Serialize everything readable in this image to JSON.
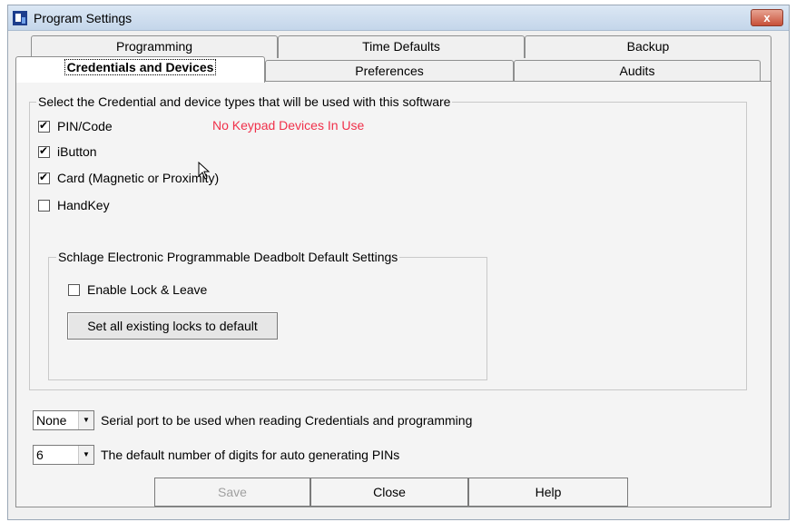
{
  "window": {
    "title": "Program Settings",
    "close_glyph": "x"
  },
  "tabs_back": [
    {
      "label": "Programming",
      "key": "r"
    },
    {
      "label": "Time Defaults",
      "key": "T"
    },
    {
      "label": "Backup",
      "key": "B"
    }
  ],
  "tabs_front": [
    {
      "label": "Credentials and Devices",
      "active": true
    },
    {
      "label": "Preferences"
    },
    {
      "label": "Audits"
    }
  ],
  "credentials_group": {
    "legend": "Select the Credential and device types that will be used with this software",
    "items": [
      {
        "label": "PIN/Code",
        "checked": true
      },
      {
        "label": "iButton",
        "checked": true
      },
      {
        "label": "Card (Magnetic or Proximity)",
        "checked": true
      },
      {
        "label": "HandKey",
        "checked": false
      }
    ],
    "warning": "No Keypad Devices In Use",
    "warning_color": "#f0304a"
  },
  "schlage_group": {
    "legend": "Schlage Electronic Programmable Deadbolt Default Settings",
    "enable_lock_leave": {
      "label": "Enable Lock & Leave",
      "checked": false
    },
    "set_default_button": "Set all existing locks to default"
  },
  "serial_port": {
    "value": "None",
    "label": "Serial port to be used when reading Credentials and programming"
  },
  "pin_digits": {
    "value": "6",
    "label": "The default number of digits for auto generating PINs"
  },
  "buttons": {
    "save": "Save",
    "close": "Close",
    "help": "Help",
    "save_enabled": false
  },
  "icons": [
    "app-icon",
    "close-icon",
    "checkbox-icon",
    "dropdown-arrow-icon",
    "mouse-cursor-icon"
  ]
}
